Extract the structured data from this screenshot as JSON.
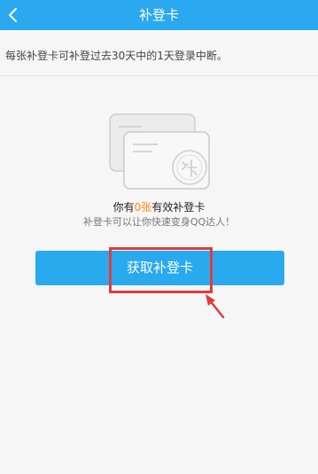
{
  "header": {
    "title": "补登卡",
    "back_icon": "chevron-left-icon"
  },
  "main": {
    "intro": "每张补登卡可补登过去30天中的1天登录中断。",
    "illustration_icon": "supplement-card-icon",
    "count_prefix": "你有",
    "count_value": "0张",
    "count_suffix": "有效补登卡",
    "hint": "补登卡可以让你快速变身QQ达人！",
    "get_button_label": "获取补登卡"
  },
  "annotation": {
    "arrow_icon": "red-arrow-icon"
  },
  "colors": {
    "titlebar": "#2aa8f0",
    "button": "#29a9ee",
    "count_highlight": "#ff8a00",
    "annotation_red": "#e23b3b",
    "background": "#f6f6f6"
  }
}
